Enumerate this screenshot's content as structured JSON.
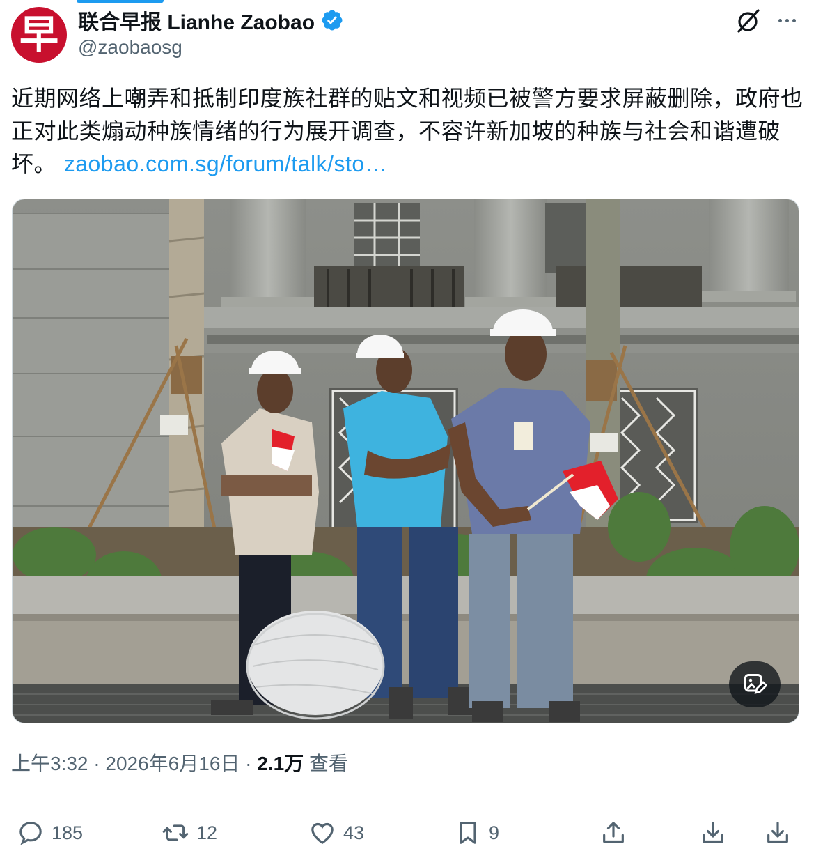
{
  "account": {
    "display_name": "联合早报 Lianhe Zaobao",
    "handle": "@zaobaosg",
    "avatar_glyph": "早",
    "avatar_color": "#c8102e",
    "verified_color": "#1d9bf0"
  },
  "tweet": {
    "text": "近期网络上嘲弄和抵制印度族社群的贴文和视频已被警方要求屏蔽删除，政府也正对此类煽动种族情绪的行为展开调查，不容许新加坡的种族与社会和谐遭破坏。",
    "link": "zaobao.com.sg/forum/talk/sto…",
    "link_color": "#1d9bf0"
  },
  "media": {
    "type": "photo",
    "badge_icon": "image-edit-icon"
  },
  "meta": {
    "time": "上午3:32",
    "separator": " · ",
    "date": "2026年6月16日",
    "views_count": "2.1万",
    "views_label": " 查看"
  },
  "actions": {
    "replies": "185",
    "reposts": "12",
    "likes": "43",
    "bookmarks": "9"
  },
  "icons": {
    "grok": "grok-icon",
    "more": "more-icon",
    "reply": "reply-icon",
    "repost": "repost-icon",
    "like": "heart-icon",
    "bookmark": "bookmark-icon",
    "share": "share-icon",
    "download": "download-icon"
  }
}
